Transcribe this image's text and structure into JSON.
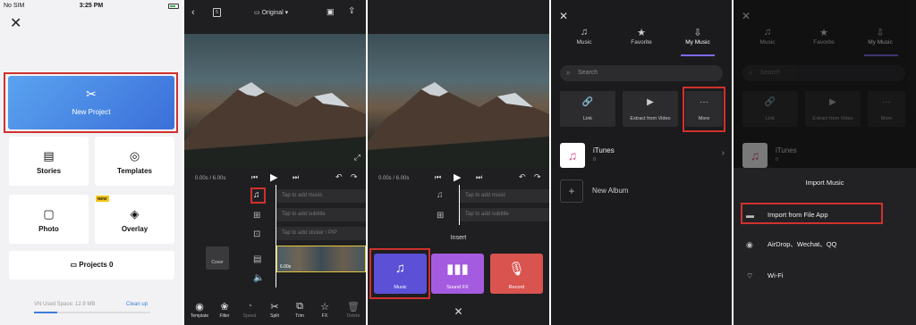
{
  "panel1": {
    "status": {
      "carrier": "No SIM",
      "time": "3:25 PM"
    },
    "new_project": "New Project",
    "cards": {
      "stories": "Stories",
      "templates": "Templates",
      "photo": "Photo",
      "overlay": "Overlay",
      "new_badge": "NEW"
    },
    "projects": "Projects 0",
    "space": "VN Used Space: 12.9 MB",
    "cleanup": "Clean up",
    "space_used_fraction": 0.2
  },
  "panel2": {
    "ratio": "Original",
    "time": "0.00s / 6.00s",
    "tracks": {
      "music": "Tap to add music",
      "subtitle": "Tap to add subtitle",
      "sticker": "Tap to add sticker / PIP"
    },
    "cover": "Cover",
    "clip_time": "6.00s",
    "tools": [
      "Template",
      "Filter",
      "Speed",
      "Split",
      "Trim",
      "FX",
      "Delete"
    ]
  },
  "panel3": {
    "time": "0.00s / 6.00s",
    "tracks": {
      "music": "Tap to add music",
      "subtitle": "Tap to add subtitle"
    },
    "insert_title": "Insert",
    "options": [
      {
        "label": "Music",
        "color": "#5b50d6"
      },
      {
        "label": "Sound FX",
        "color": "#a55be0"
      },
      {
        "label": "Record",
        "color": "#d9534f"
      }
    ]
  },
  "panel4": {
    "tabs": [
      "Music",
      "Favorite",
      "My Music"
    ],
    "search": "Search",
    "sources": [
      "Link",
      "Extract from Video",
      "More"
    ],
    "itunes": {
      "name": "iTunes",
      "count": "0"
    },
    "new_album": "New Album"
  },
  "panel5": {
    "tabs": [
      "Music",
      "Favorite",
      "My Music"
    ],
    "search": "Search",
    "sources": [
      "Link",
      "Extract from Video",
      "More"
    ],
    "itunes": {
      "name": "iTunes",
      "count": "0"
    },
    "import_title": "Import Music",
    "import_options": [
      "Import from File App",
      "AirDrop、Wechat、QQ",
      "Wi-Fi"
    ]
  },
  "colors": {
    "accent": "#7c6bf0",
    "highlight": "#d0312d",
    "brand_blue": "#3b6fd9"
  }
}
